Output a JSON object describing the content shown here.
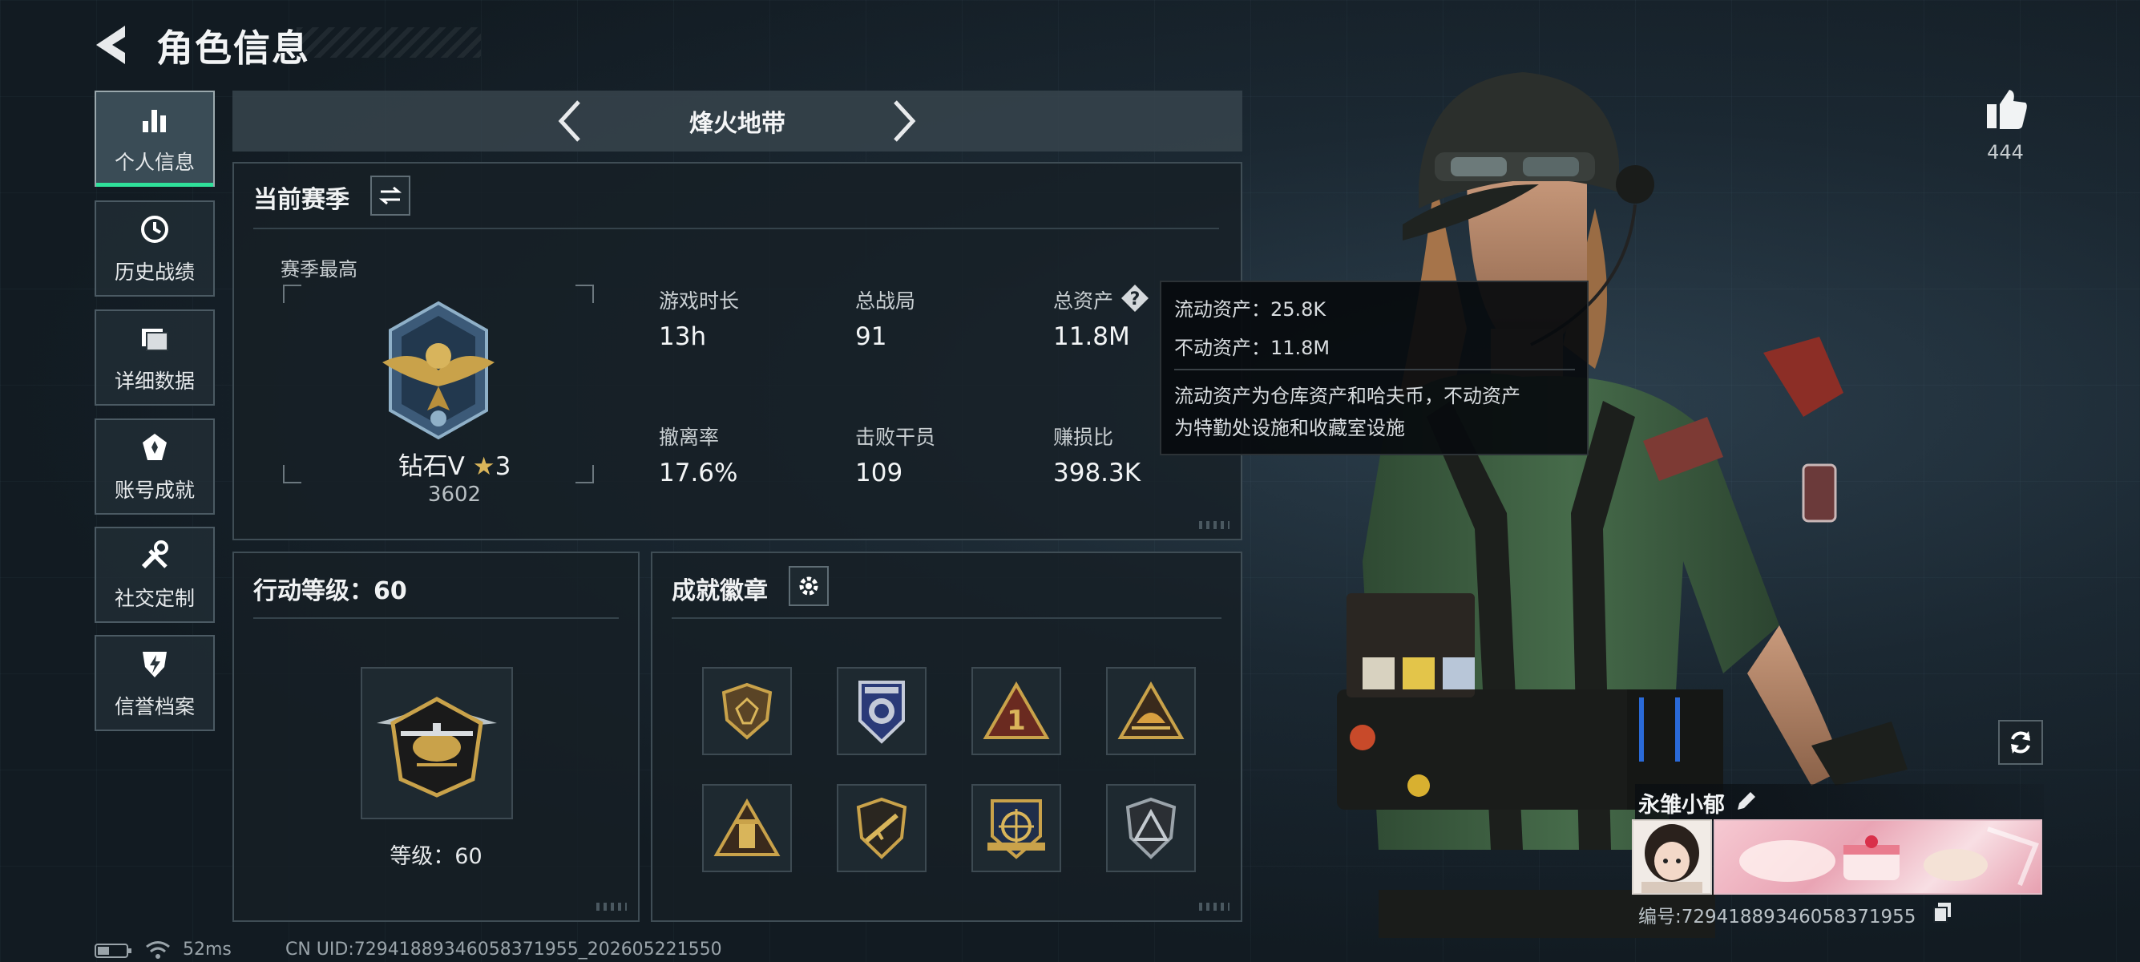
{
  "header": {
    "title": "角色信息"
  },
  "sidebar": {
    "items": [
      {
        "label": "个人信息",
        "icon": "bar-chart-icon",
        "active": true
      },
      {
        "label": "历史战绩",
        "icon": "history-icon",
        "active": false
      },
      {
        "label": "详细数据",
        "icon": "folder-icon",
        "active": false
      },
      {
        "label": "账号成就",
        "icon": "achievement-icon",
        "active": false
      },
      {
        "label": "社交定制",
        "icon": "tools-icon",
        "active": false
      },
      {
        "label": "信誉档案",
        "icon": "shield-icon",
        "active": false
      }
    ]
  },
  "mode_tabs": {
    "current": "烽火地带"
  },
  "season": {
    "title": "当前赛季",
    "best_label": "赛季最高",
    "rank_name": "钻石V",
    "rank_stars": "3",
    "rank_score": "3602",
    "stats": [
      {
        "label": "游戏时长",
        "value": "13h"
      },
      {
        "label": "总战局",
        "value": "91"
      },
      {
        "label": "总资产",
        "value": "11.8M"
      },
      {
        "label": "撤离率",
        "value": "17.6%"
      },
      {
        "label": "击败干员",
        "value": "109"
      },
      {
        "label": "赚损比",
        "value": "398.3K"
      }
    ]
  },
  "tooltip": {
    "liquid": "流动资产：25.8K",
    "fixed": "不动资产：11.8M",
    "desc_line1": "流动资产为仓库资产和哈夫币，不动资产",
    "desc_line2": "为特勤处设施和收藏室设施"
  },
  "action_level": {
    "title": "行动等级：60",
    "level_text": "等级：60",
    "level": 60
  },
  "badges": {
    "title": "成就徽章",
    "items": [
      "shield-badge-icon",
      "eagle-badge-icon",
      "number-one-badge-icon",
      "sunrise-badge-icon",
      "tower-badge-icon",
      "rifle-badge-icon",
      "crosshair-badge-icon",
      "peak-badge-icon"
    ]
  },
  "likes": {
    "count": "444"
  },
  "player": {
    "name": "永雏小郁",
    "id_text": "编号:72941889346058371955"
  },
  "status": {
    "ping": "52ms",
    "uid": "CN UID:72941889346058371955_202605221550"
  },
  "colors": {
    "accent_green": "#2fe09a",
    "gold": "#c9a24a",
    "panel_border": "#3f4d55"
  }
}
